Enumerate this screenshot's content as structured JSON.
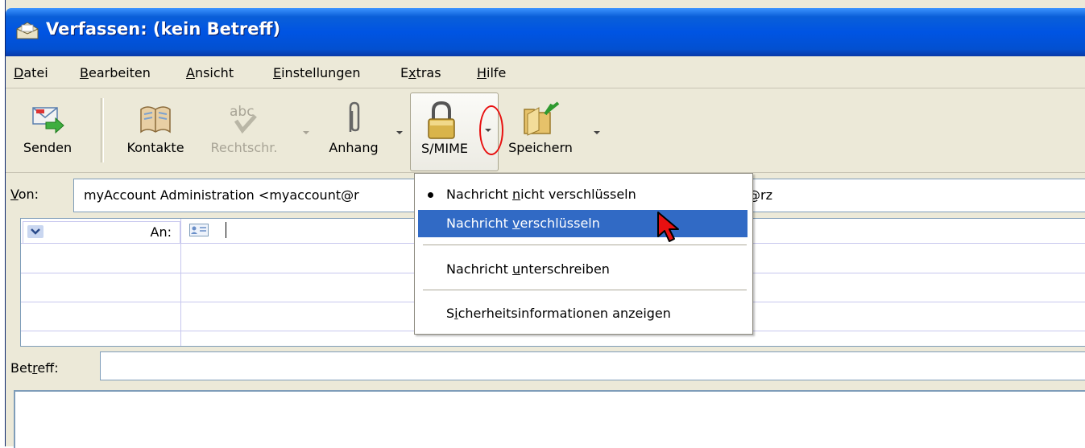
{
  "window": {
    "title": "Verfassen: (kein Betreff)"
  },
  "menubar": {
    "items": [
      {
        "label": "Datei",
        "mnemonic": "D"
      },
      {
        "label": "Bearbeiten",
        "mnemonic": "B"
      },
      {
        "label": "Ansicht",
        "mnemonic": "A"
      },
      {
        "label": "Einstellungen",
        "mnemonic": "E"
      },
      {
        "label": "Extras",
        "mnemonic": "x"
      },
      {
        "label": "Hilfe",
        "mnemonic": "H"
      }
    ]
  },
  "toolbar": {
    "send_label": "Senden",
    "contacts_label": "Kontakte",
    "spell_label": "Rechtschr.",
    "attach_label": "Anhang",
    "smime_label": "S/MIME",
    "save_label": "Speichern"
  },
  "header": {
    "from_label": "Von:",
    "from_value": "myAccount Administration <myaccount@r",
    "from_value_tail": "@rz",
    "address_type": "An:",
    "subject_label": "Betreff:",
    "subject_value": ""
  },
  "smime_menu": {
    "items": [
      {
        "label": "Nachricht nicht verschlüsseln",
        "checked": true,
        "highlighted": false
      },
      {
        "label": "Nachricht verschlüsseln",
        "checked": false,
        "highlighted": true
      },
      {
        "label": "Nachricht unterschreiben",
        "checked": false,
        "highlighted": false
      },
      {
        "label": "Sicherheitsinformationen anzeigen",
        "checked": false,
        "highlighted": false
      }
    ]
  },
  "colors": {
    "titlebar": "#0054e3",
    "menu_highlight": "#316ac5",
    "annotation": "#e81010"
  }
}
